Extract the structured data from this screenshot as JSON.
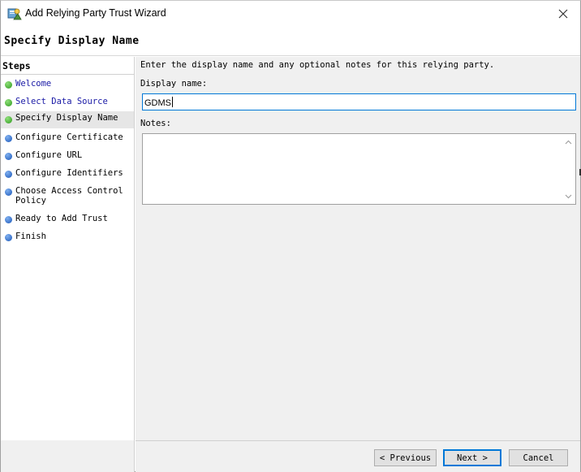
{
  "window": {
    "title": "Add Relying Party Trust Wizard",
    "app_icon": "adfs-wizard-icon",
    "close_icon": "close-icon"
  },
  "header": {
    "page_title": "Specify Display Name"
  },
  "steps": {
    "heading": "Steps",
    "items": [
      {
        "label": "Welcome",
        "status": "complete"
      },
      {
        "label": "Select Data Source",
        "status": "complete"
      },
      {
        "label": "Specify Display Name",
        "status": "current"
      },
      {
        "label": "Configure Certificate",
        "status": "pending"
      },
      {
        "label": "Configure URL",
        "status": "pending"
      },
      {
        "label": "Configure Identifiers",
        "status": "pending"
      },
      {
        "label": "Choose Access Control Policy",
        "status": "pending"
      },
      {
        "label": "Ready to Add Trust",
        "status": "pending"
      },
      {
        "label": "Finish",
        "status": "pending"
      }
    ]
  },
  "main": {
    "instructions": "Enter the display name and any optional notes for this relying party.",
    "display_name_label": "Display name:",
    "display_name_value": "GDMS",
    "notes_label": "Notes:",
    "notes_value": ""
  },
  "buttons": {
    "previous": "< Previous",
    "next": "Next >",
    "cancel": "Cancel"
  },
  "colors": {
    "accent": "#0078d7",
    "link": "#1a1aa6",
    "step_complete": "#2f9a1e",
    "step_pending": "#1a56b8"
  }
}
